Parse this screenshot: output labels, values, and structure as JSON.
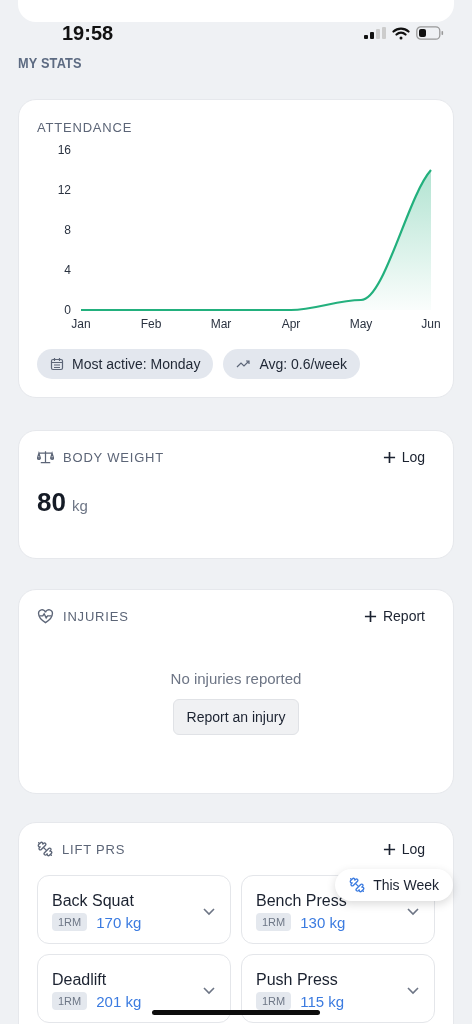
{
  "status_bar": {
    "time": "19:58"
  },
  "section_title": "MY STATS",
  "attendance": {
    "title": "ATTENDANCE",
    "chart_data": {
      "type": "area",
      "categories": [
        "Jan",
        "Feb",
        "Mar",
        "Apr",
        "May",
        "Jun"
      ],
      "series": [
        {
          "color": "#22b07d",
          "values": [
            0,
            0,
            0,
            0,
            1,
            14
          ]
        }
      ],
      "ylim": [
        0,
        16
      ],
      "yticks": [
        0,
        4,
        8,
        12,
        16
      ]
    },
    "pills": [
      {
        "kind": "calendar",
        "label": "Most active: Monday"
      },
      {
        "kind": "trend",
        "label": "Avg: 0.6/week"
      }
    ]
  },
  "body_weight": {
    "title": "BODY WEIGHT",
    "action": "Log",
    "value": "80",
    "unit": "kg"
  },
  "injuries": {
    "title": "INJURIES",
    "action": "Report",
    "empty_text": "No injuries reported",
    "button": "Report an injury"
  },
  "lift_prs": {
    "title": "LIFT PRS",
    "action": "Log",
    "popover": "This Week",
    "lifts": [
      {
        "name": "Back Squat",
        "badge": "1RM",
        "value": "170 kg"
      },
      {
        "name": "Bench Press",
        "badge": "1RM",
        "value": "130 kg"
      },
      {
        "name": "Deadlift",
        "badge": "1RM",
        "value": "201 kg"
      },
      {
        "name": "Push Press",
        "badge": "1RM",
        "value": "115 kg"
      }
    ]
  }
}
